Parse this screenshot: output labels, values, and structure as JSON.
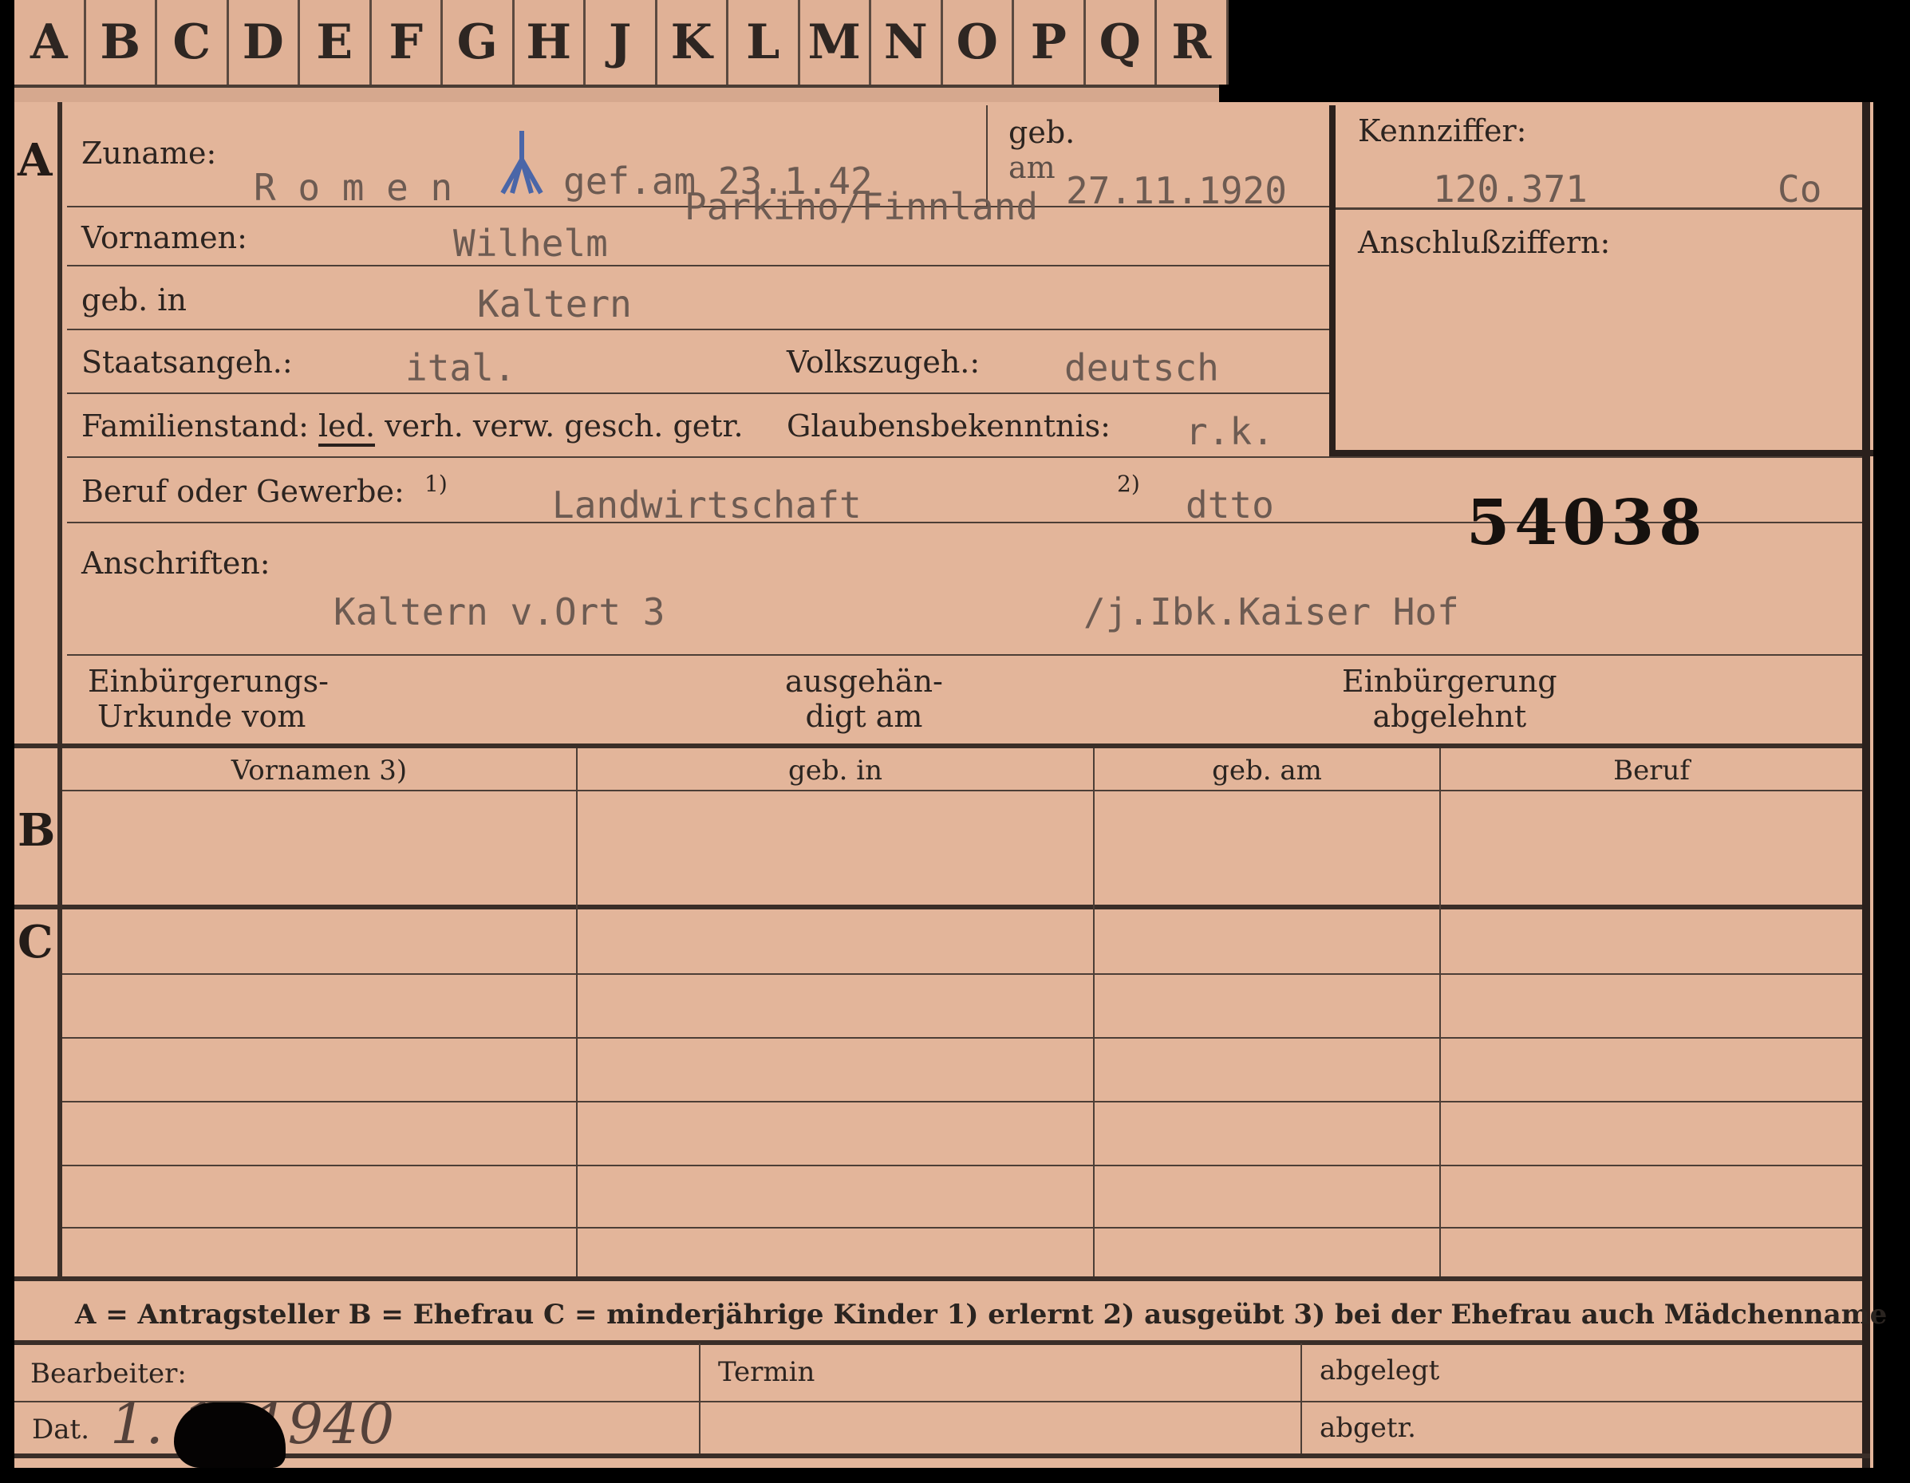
{
  "tabs": [
    "A",
    "B",
    "C",
    "D",
    "E",
    "F",
    "G",
    "H",
    "J",
    "K",
    "L",
    "M",
    "N",
    "O",
    "P",
    "Q",
    "R"
  ],
  "sections": {
    "a": "A",
    "b": "B",
    "c": "C"
  },
  "labels": {
    "zuname": "Zuname:",
    "geb": "geb.",
    "geb_am": "am",
    "vornamen": "Vornamen:",
    "geb_in": "geb. in",
    "staats": "Staatsangeh.:",
    "volks": "Volkszugeh.:",
    "famstand": "Familienstand:",
    "fam_led": "led.",
    "fam_rest": "verh. verw. gesch. getr.",
    "glaube": "Glaubensbekenntnis:",
    "beruf": "Beruf oder Gewerbe:",
    "fn1": "1)",
    "fn2": "2)",
    "anschriften": "Anschriften:",
    "einb1": "Einbürgerungs-",
    "einb2": "Urkunde vom",
    "ausg1": "ausgehän-",
    "ausg2": "digt am",
    "abg1": "Einbürgerung",
    "abg2": "abgelehnt",
    "kennziffer": "Kennziffer:",
    "anschluss": "Anschlußziffern:"
  },
  "values": {
    "zuname": "R o m e n",
    "gefallen": "gef.am 23.1.42",
    "ort_gefallen": "Parkino/Finnland",
    "geb_datum": "27.11.1920",
    "vornamen": "Wilhelm",
    "geb_in": "Kaltern",
    "staats": "ital.",
    "volks": "deutsch",
    "glaube": "r.k.",
    "beruf_erlernt": "Landwirtschaft",
    "beruf_ausgeuebt": "dtto",
    "anschrift1": "Kaltern v.Ort 3",
    "anschrift2": "/j.Ibk.Kaiser Hof",
    "kennziffer": "120.371",
    "kennziffer_suffix": "Co",
    "nummer": "54038"
  },
  "table_headers": [
    "Vornamen 3)",
    "geb. in",
    "geb. am",
    "Beruf"
  ],
  "legend": "A = Antragsteller   B = Ehefrau   C = minderjährige Kinder   1) erlernt   2) ausgeübt   3) bei der Ehefrau auch Mädchenname",
  "bottom": {
    "bearbeiter": "Bearbeiter:",
    "dat": "Dat.",
    "datum": "1. 1. 1940",
    "termin": "Termin",
    "abgelegt": "abgelegt",
    "abgetr": "abgetr."
  }
}
